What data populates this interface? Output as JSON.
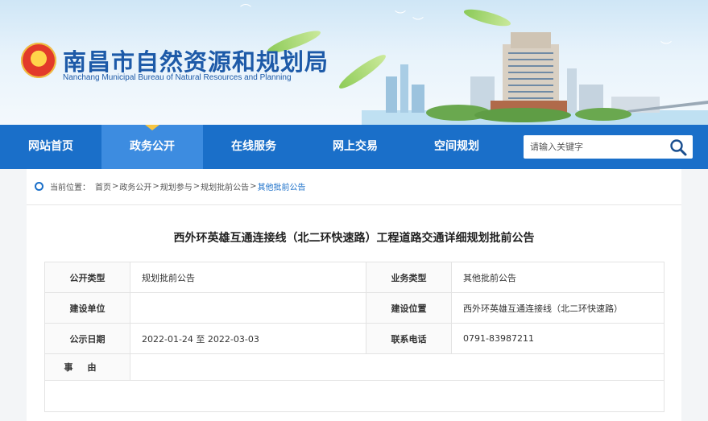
{
  "header": {
    "title": "南昌市自然资源和规划局",
    "subtitle": "Nanchang Municipal Bureau of Natural Resources and Planning"
  },
  "nav": {
    "items": [
      {
        "label": "网站首页"
      },
      {
        "label": "政务公开"
      },
      {
        "label": "在线服务"
      },
      {
        "label": "网上交易"
      },
      {
        "label": "空间规划"
      }
    ],
    "active_index": 1,
    "search_placeholder": "请输入关键字"
  },
  "breadcrumb": {
    "prefix": "当前位置：",
    "items": [
      "首页",
      "政务公开",
      "规划参与",
      "规划批前公告"
    ],
    "current": "其他批前公告",
    "separator": ">"
  },
  "article": {
    "title": "西外环英雄互通连接线（北二环快速路）工程道路交通详细规划批前公告",
    "rows": [
      {
        "k1": "公开类型",
        "v1": "规划批前公告",
        "k2": "业务类型",
        "v2": "其他批前公告"
      },
      {
        "k1": "建设单位",
        "v1": "",
        "k2": "建设位置",
        "v2": "西外环英雄互通连接线（北二环快速路）"
      },
      {
        "k1": "公示日期",
        "v1": "2022-01-24 至 2022-03-03",
        "k2": "联系电话",
        "v2": "0791-83987211"
      }
    ],
    "reason_label": "事由",
    "reason_value": ""
  },
  "colors": {
    "nav_bg": "#1a6fc9",
    "nav_active": "#3d8ce0",
    "title_blue": "#1d5aa8",
    "accent_yellow": "#f6c542"
  }
}
